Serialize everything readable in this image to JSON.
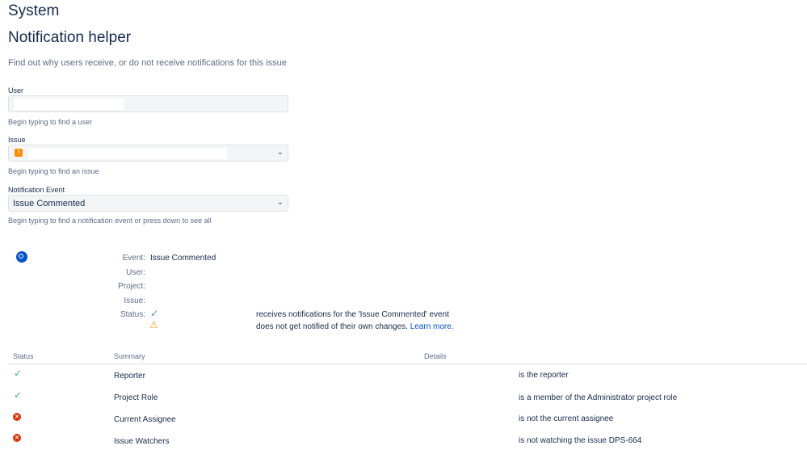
{
  "page": {
    "section_title": "System",
    "title": "Notification helper",
    "description": "Find out why users receive, or do not receive notifications for this issue"
  },
  "form": {
    "user": {
      "label": "User",
      "value": "",
      "hint": "Begin typing to find a user"
    },
    "issue": {
      "label": "Issue",
      "value": "",
      "hint": "Begin typing to find an issue",
      "icon": "issue-type-icon"
    },
    "event": {
      "label": "Notification Event",
      "value": "Issue Commented",
      "hint": "Begin typing to find a notification event or press down to see all"
    }
  },
  "result": {
    "icon": "info-icon",
    "event_label": "Event:",
    "event_value": "Issue Commented",
    "user_label": "User:",
    "project_label": "Project:",
    "issue_label": "Issue:",
    "status_label": "Status:",
    "status_icons": [
      "check-icon",
      "warning-icon"
    ],
    "message_line1": "receives notifications for the 'Issue Commented' event",
    "message_line2": "does not get notified of their own changes.",
    "learn_more": "Learn more",
    "period": "."
  },
  "table": {
    "headers": [
      "Status",
      "Summary",
      "Details"
    ],
    "rows": [
      {
        "status": "ok",
        "summary": "Reporter",
        "details": "is the reporter"
      },
      {
        "status": "ok",
        "summary": "Project Role",
        "details": "is a member of the Administrator project role"
      },
      {
        "status": "error",
        "summary": "Current Assignee",
        "details": "is not the current assignee"
      },
      {
        "status": "error",
        "summary": "Issue Watchers",
        "details": "is not watching the issue DPS-664"
      }
    ]
  },
  "colors": {
    "ok": "#36b37e",
    "error": "#de350b",
    "warning": "#ff991f",
    "link": "#0052cc"
  }
}
